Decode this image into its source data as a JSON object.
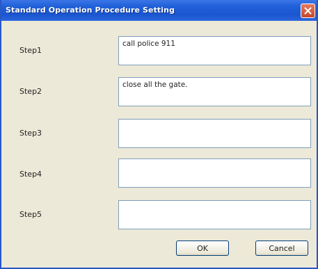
{
  "window": {
    "title": "Standard Operation Procedure Setting"
  },
  "steps": [
    {
      "label": "Step1",
      "value": "call police 911"
    },
    {
      "label": "Step2",
      "value": "close all the gate."
    },
    {
      "label": "Step3",
      "value": ""
    },
    {
      "label": "Step4",
      "value": ""
    },
    {
      "label": "Step5",
      "value": ""
    }
  ],
  "buttons": {
    "ok_label": "OK",
    "cancel_label": "Cancel"
  },
  "colors": {
    "titlebar": "#2060d8",
    "close_button": "#c8462a",
    "dialog_bg": "#ece9d8",
    "field_border": "#7f9db9"
  },
  "icons": {
    "close": "close-icon"
  }
}
